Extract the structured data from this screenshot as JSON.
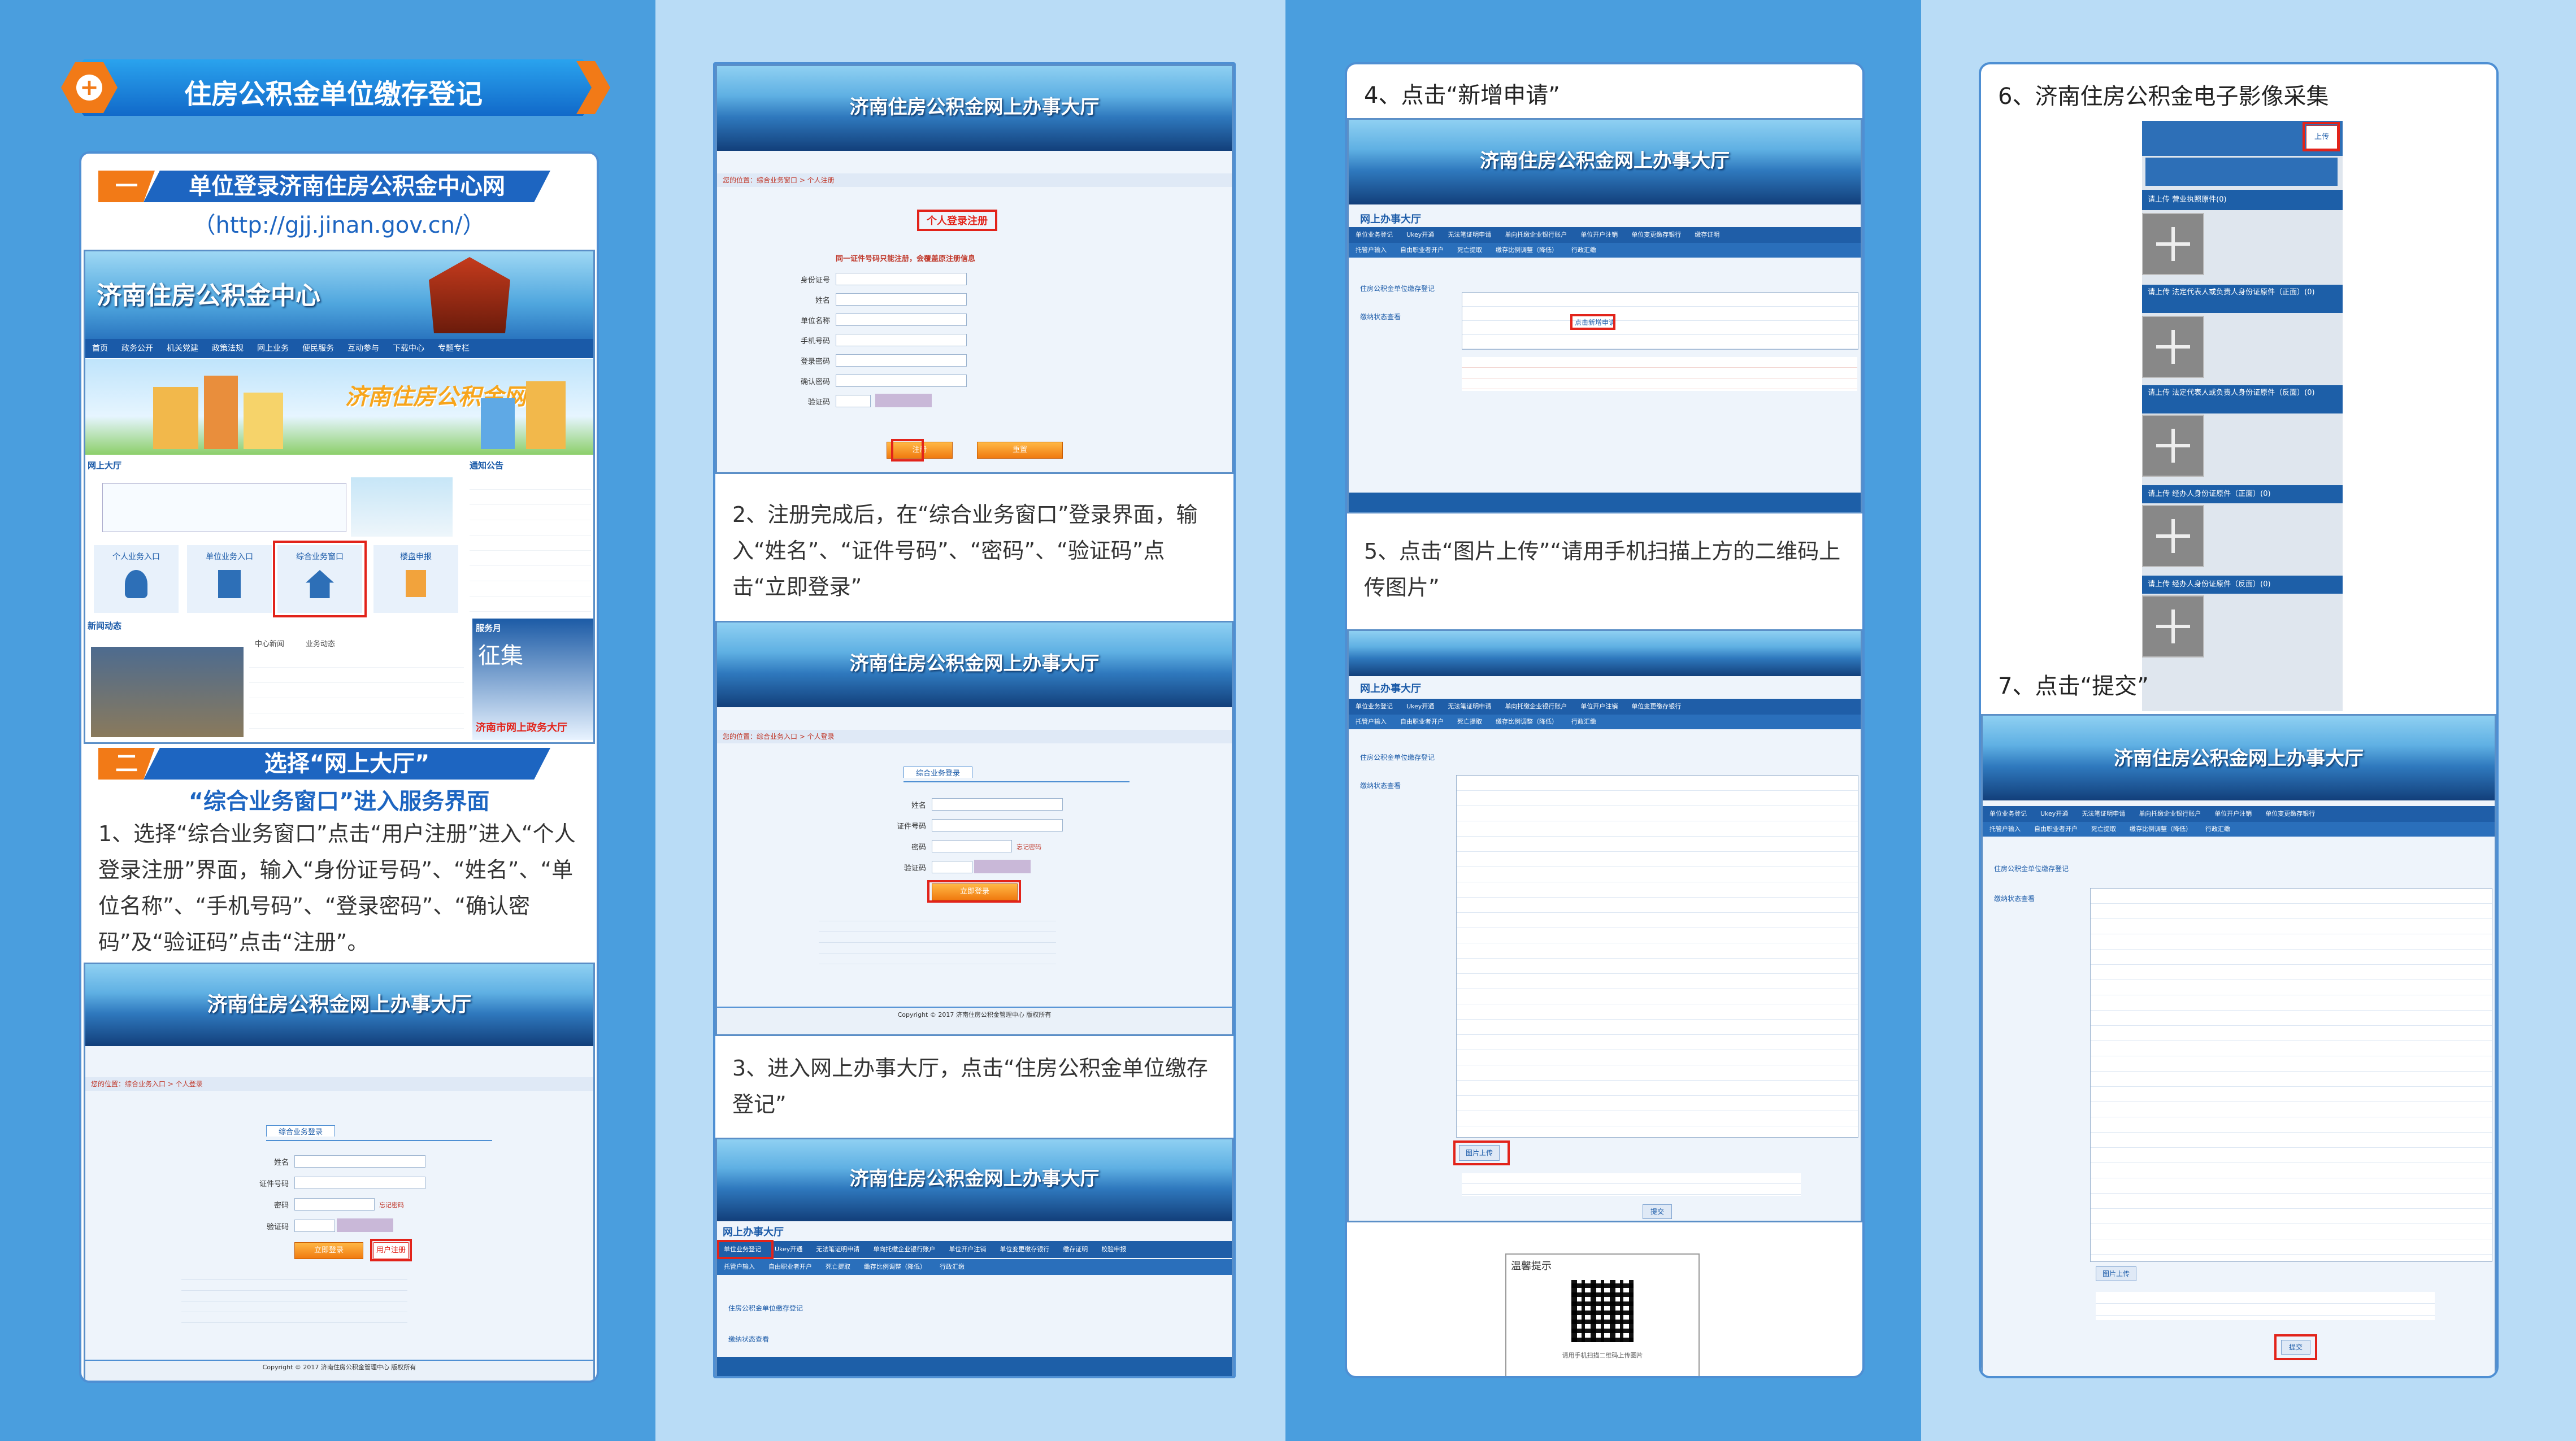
{
  "col1": {
    "badge_icon": "plus-icon",
    "banner_title": "住房公积金单位缴存登记",
    "section1": {
      "num": "一",
      "title": "单位登录济南住房公积金中心网",
      "url": "（http://gjj.jinan.gov.cn/）"
    },
    "site": {
      "name": "济南住房公积金中心",
      "nav": [
        "首页",
        "政务公开",
        "机关党建",
        "政策法规",
        "网上业务",
        "便民服务",
        "互动参与",
        "下载中心",
        "专题专栏"
      ],
      "slogan": "济南住房公积金网",
      "online_hall": "网上大厅",
      "notice": "通知公告",
      "entries": [
        "个人业务入口",
        "单位业务入口",
        "综合业务窗口",
        "楼盘申报"
      ],
      "news": "新闻动态",
      "news_tabs": [
        "中心新闻",
        "业务动态"
      ],
      "promo": [
        "服务月",
        "征集",
        "济南市网上政务大厅"
      ]
    },
    "section2": {
      "num": "二",
      "title": "选择“网上大厅”",
      "subtitle": "“综合业务窗口”进入服务界面"
    },
    "step1_text": "1、选择“综合业务窗口”点击“用户注册”进入“个人登录注册”界面，输入“身份证号码”、“姓名”、“单位名称”、“手机号码”、“登录密码”、“确认密码”及“验证码”点击“注册”。",
    "login": {
      "header": "济南住房公积金网上办事大厅",
      "crumb": "您的位置：综合业务入口 > 个人登录",
      "box_title": "综合业务登录",
      "fields": [
        "姓名",
        "证件号码",
        "密码",
        "验证码"
      ],
      "forgot": "忘记密码",
      "btn_login": "立即登录",
      "btn_register": "用户注册",
      "copyright": "Copyright © 2017 济南住房公积金管理中心 版权所有"
    }
  },
  "col2": {
    "register": {
      "crumb": "您的位置：综合业务窗口 > 个人注册",
      "title": "个人登录注册",
      "warn": "同一证件号码只能注册，会覆盖原注册信息",
      "fields": [
        "身份证号",
        "姓名",
        "单位名称",
        "手机号码",
        "登录密码",
        "确认密码",
        "验证码"
      ],
      "btn_register": "注册",
      "btn_reset": "重置"
    },
    "step2_text": "2、注册完成后，在“综合业务窗口”登录界面，输入“姓名”、“证件号码”、“密码”、“验证码”点击“立即登录”",
    "step3_text": "3、进入网上办事大厅，点击“住房公积金单位缴存登记”",
    "hall": {
      "title": "网上办事大厅",
      "tabs": [
        "单位业务登记",
        "Ukey开通",
        "无法笔证明申请",
        "单向托缴企业银行账户",
        "单位开户注销",
        "单位变更缴存银行",
        "缴存证明",
        "校验申报"
      ],
      "tabs2": [
        "托管户输入",
        "自由职业者开户",
        "死亡提取",
        "缴存比例调整（降低）",
        "行政汇缴"
      ],
      "side": [
        "住房公积金单位缴存登记",
        "缴纳状态查看"
      ]
    }
  },
  "col3": {
    "step4_text": "4、点击“新增申请”",
    "new_apply": "点击新增申请",
    "step5_text": "5、点击“图片上传”“请用手机扫描上方的二维码上传图片”",
    "upload_btn": "图片上传",
    "submit_btn": "提交",
    "qr_title": "温馨提示",
    "qr_caption": "请用手机扫描二维码上传图片"
  },
  "col4": {
    "step6_text": "6、济南住房公积金电子影像采集",
    "upload_label": "上传",
    "slots": [
      "请上传 营业执照原件(0)",
      "请上传 法定代表人或负责人身份证原件（正面）(0)",
      "请上传 法定代表人或负责人身份证原件（反面）(0)",
      "请上传 经办人身份证原件（正面）(0)",
      "请上传 经办人身份证原件（反面）(0)"
    ],
    "step7_text": "7、点击“提交”"
  },
  "colors": {
    "blue": "#1f5ea8",
    "red": "#e2231a",
    "orange": "#f07a10",
    "bg_dark": "#4a9ede",
    "bg_light": "#b9dcf6"
  }
}
